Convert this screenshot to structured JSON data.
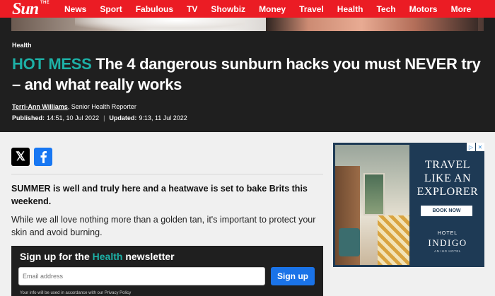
{
  "brand": {
    "the": "THE",
    "name": "Sun"
  },
  "nav": {
    "items": [
      "News",
      "Sport",
      "Fabulous",
      "TV",
      "Showbiz",
      "Money",
      "Travel",
      "Health",
      "Tech",
      "Motors",
      "More"
    ],
    "active": "Health"
  },
  "article": {
    "section": "Health",
    "kicker": "HOT MESS",
    "headline": "The 4 dangerous sunburn hacks you must NEVER try – and what really works",
    "author": "Terri-Ann Williams",
    "author_role": ", Senior Health Reporter",
    "published_label": "Published:",
    "published": "14:51, 10 Jul 2022",
    "updated_label": "Updated:",
    "updated": "9:13, 11 Jul 2022",
    "lead": "SUMMER is well and truly here and a heatwave is set to bake Brits this weekend.",
    "paragraph": "While we all love nothing more than a golden tan, it's important to protect your skin and avoid burning."
  },
  "social": {
    "x_glyph": "𝕏",
    "fb_glyph": "f"
  },
  "newsletter": {
    "title_prefix": "Sign up for the",
    "title_highlight": "Health",
    "title_suffix": "newsletter",
    "email_placeholder": "Email address",
    "button": "Sign up",
    "note": "Your info will be used in accordance with our Privacy Policy"
  },
  "ad": {
    "headline": "TRAVEL LIKE AN EXPLORER",
    "cta": "BOOK NOW",
    "brand_small": "HOTEL",
    "brand": "INDIGO",
    "brand_sub": "AN IHG HOTEL"
  },
  "colors": {
    "brand_red": "#eb1c24",
    "teal": "#1db0a6",
    "dark": "#1f1f1f",
    "blue_button": "#1a73e8",
    "ad_navy": "#1e3a55"
  }
}
